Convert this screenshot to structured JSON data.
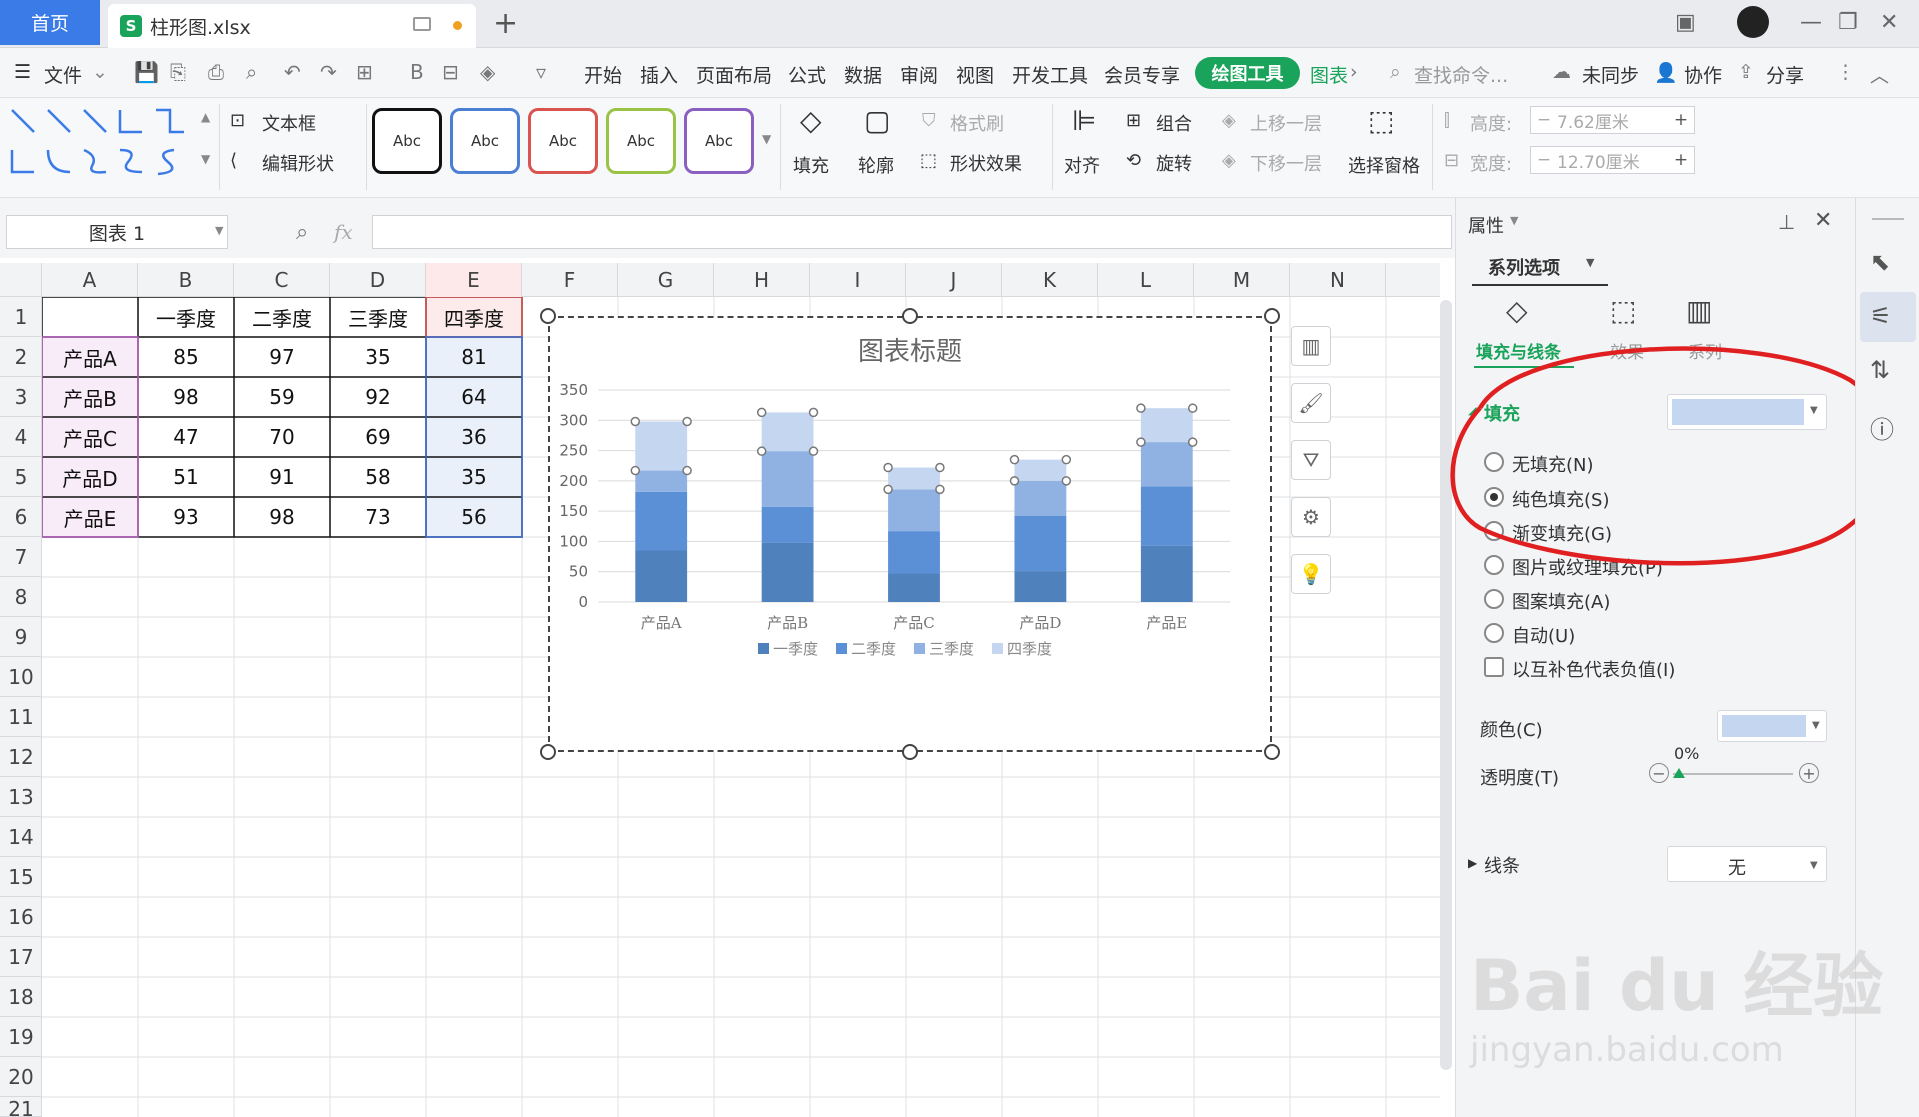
{
  "titlebar": {
    "home_tab": "首页",
    "file_icon": "S",
    "file_name": "柱形图.xlsx",
    "new_tab": "+"
  },
  "menubar": {
    "file_menu": "文件",
    "items": [
      "开始",
      "插入",
      "页面布局",
      "公式",
      "数据",
      "审阅",
      "视图",
      "开发工具",
      "会员专享"
    ],
    "active_tool": "绘图工具",
    "chart_tool": "图表",
    "search_placeholder": "查找命令...",
    "sync": "未同步",
    "collab": "协作",
    "share": "分享"
  },
  "ribbon": {
    "text_box": "文本框",
    "edit_shape": "编辑形状",
    "style_presets": [
      {
        "label": "Abc",
        "color": "#111111"
      },
      {
        "label": "Abc",
        "color": "#4a7fd4"
      },
      {
        "label": "Abc",
        "color": "#d9534f"
      },
      {
        "label": "Abc",
        "color": "#9ac245"
      },
      {
        "label": "Abc",
        "color": "#8a5fc0"
      }
    ],
    "fill": "填充",
    "outline": "轮廓",
    "format_painter": "格式刷",
    "shape_effect": "形状效果",
    "align": "对齐",
    "group": "组合",
    "rotate": "旋转",
    "bring_forward": "上移一层",
    "send_backward": "下移一层",
    "selection_pane": "选择窗格",
    "height_label": "高度:",
    "height_value": "7.62厘米",
    "width_label": "宽度:",
    "width_value": "12.70厘米"
  },
  "formulabar": {
    "name_box": "图表 1",
    "fx": "fx"
  },
  "sheet": {
    "columns": [
      "A",
      "B",
      "C",
      "D",
      "E",
      "F",
      "G",
      "H",
      "I",
      "J",
      "K",
      "L",
      "M",
      "N"
    ],
    "rows": [
      "1",
      "2",
      "3",
      "4",
      "5",
      "6",
      "7",
      "8",
      "9",
      "10",
      "11",
      "12",
      "13",
      "14",
      "15",
      "16",
      "17",
      "18",
      "19",
      "20",
      "21"
    ],
    "header_row": [
      "",
      "一季度",
      "二季度",
      "三季度",
      "四季度"
    ],
    "data": [
      [
        "产品A",
        "85",
        "97",
        "35",
        "81"
      ],
      [
        "产品B",
        "98",
        "59",
        "92",
        "64"
      ],
      [
        "产品C",
        "47",
        "70",
        "69",
        "36"
      ],
      [
        "产品D",
        "51",
        "91",
        "58",
        "35"
      ],
      [
        "产品E",
        "93",
        "98",
        "73",
        "56"
      ]
    ]
  },
  "chart_data": {
    "type": "bar",
    "stacked": true,
    "title": "图表标题",
    "categories": [
      "产品A",
      "产品B",
      "产品C",
      "产品D",
      "产品E"
    ],
    "series": [
      {
        "name": "一季度",
        "values": [
          85,
          98,
          47,
          51,
          93
        ],
        "color": "#4f81bd"
      },
      {
        "name": "二季度",
        "values": [
          97,
          59,
          70,
          91,
          98
        ],
        "color": "#5b8fd6"
      },
      {
        "name": "三季度",
        "values": [
          35,
          92,
          69,
          58,
          73
        ],
        "color": "#8fb2e3"
      },
      {
        "name": "四季度",
        "values": [
          81,
          64,
          36,
          35,
          56
        ],
        "color": "#c5d6f0"
      }
    ],
    "yticks": [
      "0",
      "50",
      "100",
      "150",
      "200",
      "250",
      "300",
      "350"
    ],
    "ylim": [
      0,
      350
    ],
    "grid": true,
    "legend": "bottom"
  },
  "pane": {
    "title": "属性",
    "series_options": "系列选项",
    "tabs": [
      "填充与线条",
      "效果",
      "系列"
    ],
    "fill_section": "填充",
    "fill_options": [
      "无填充(N)",
      "纯色填充(S)",
      "渐变填充(G)",
      "图片或纹理填充(P)",
      "图案填充(A)",
      "自动(U)"
    ],
    "invert_negative": "以互补色代表负值(I)",
    "color_label": "颜色(C)",
    "transparency_label": "透明度(T)",
    "transparency_value": "0%",
    "line_section": "线条",
    "line_value": "无",
    "fill_color": "#c5d6f0"
  },
  "watermark": {
    "line1": "Bai du 经验",
    "line2": "jingyan.baidu.com"
  }
}
